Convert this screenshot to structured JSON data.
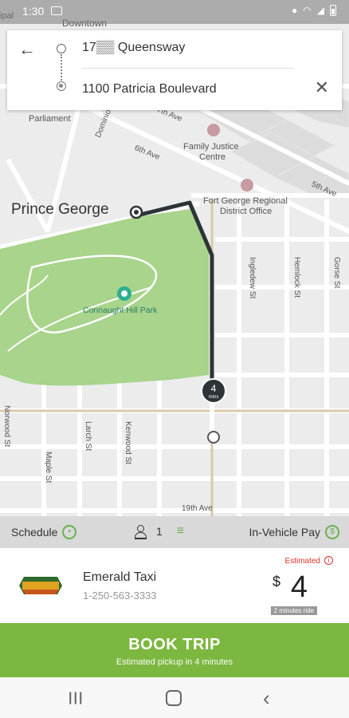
{
  "status_bar": {
    "time": "1:30"
  },
  "route": {
    "origin": "17▒▒ Queensway",
    "destination": "1100 Patricia Boulevard"
  },
  "map": {
    "city": "Prince George",
    "places": {
      "downtown": "Downtown",
      "parliament": "Parliament",
      "family_justice": "Family Justice",
      "family_justice_2": "Centre",
      "fort_george": "Fort George Regional",
      "fort_george_2": "District Office",
      "park": "Connaught Hill Park",
      "cipal": "ipal"
    },
    "streets": {
      "seventh": "7th Ave",
      "sixth": "6th Ave",
      "fifth": "5th Ave",
      "nineteenth": "19th Ave",
      "dominion": "Dominion",
      "ingledew": "Ingledew St",
      "hemlock": "Hemlock St",
      "gorse": "Gorse St",
      "norwood": "Norwood St",
      "maple": "Maple St",
      "larch": "Larch St",
      "kenwood": "Kenwood St"
    },
    "eta": {
      "value": "4",
      "unit": "mins"
    }
  },
  "options": {
    "schedule_label": "Schedule",
    "passengers": "1",
    "payment_label": "In-Vehicle Pay"
  },
  "taxi": {
    "name": "Emerald Taxi",
    "phone": "1-250-563-3333",
    "estimated_label": "Estimated",
    "currency": "$",
    "price": "4",
    "duration": "2 minutes ride"
  },
  "book": {
    "label": "BOOK TRIP",
    "subtitle": "Estimated pickup in 4 minutes"
  },
  "colors": {
    "accent_green": "#7cb740",
    "park_green": "#a8d48b",
    "route": "#2d3438",
    "estimate_red": "#d9342b"
  }
}
